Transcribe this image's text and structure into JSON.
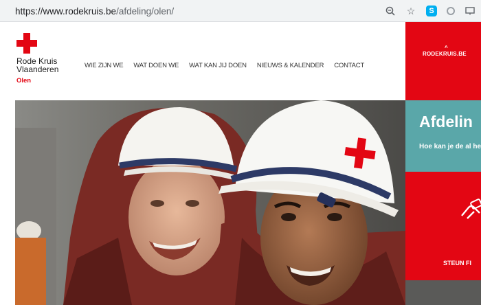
{
  "browser": {
    "url_host": "https://www.rodekruis.be",
    "url_path": "/afdeling/olen/",
    "icons": [
      "zoom-icon",
      "star-icon",
      "skype-icon",
      "extension-circle-icon",
      "cast-icon"
    ],
    "skype_letter": "S"
  },
  "site": {
    "brand_line1": "Rode Kruis",
    "brand_line2": "Vlaanderen",
    "branch": "Olen",
    "accent": "#e30613",
    "teal": "#5aa7a9"
  },
  "nav": {
    "items": [
      "WIE ZIJN WE",
      "WAT DOEN WE",
      "WAT KAN JIJ DOEN",
      "NIEUWS & KALENDER",
      "CONTACT"
    ]
  },
  "sidebar": {
    "rk_link": "RODEKRUIS.BE",
    "afdeling_title": "Afdelin",
    "afdeling_subtitle": "Hoe kan je de al helpen?",
    "steun": "STEUN FI"
  }
}
